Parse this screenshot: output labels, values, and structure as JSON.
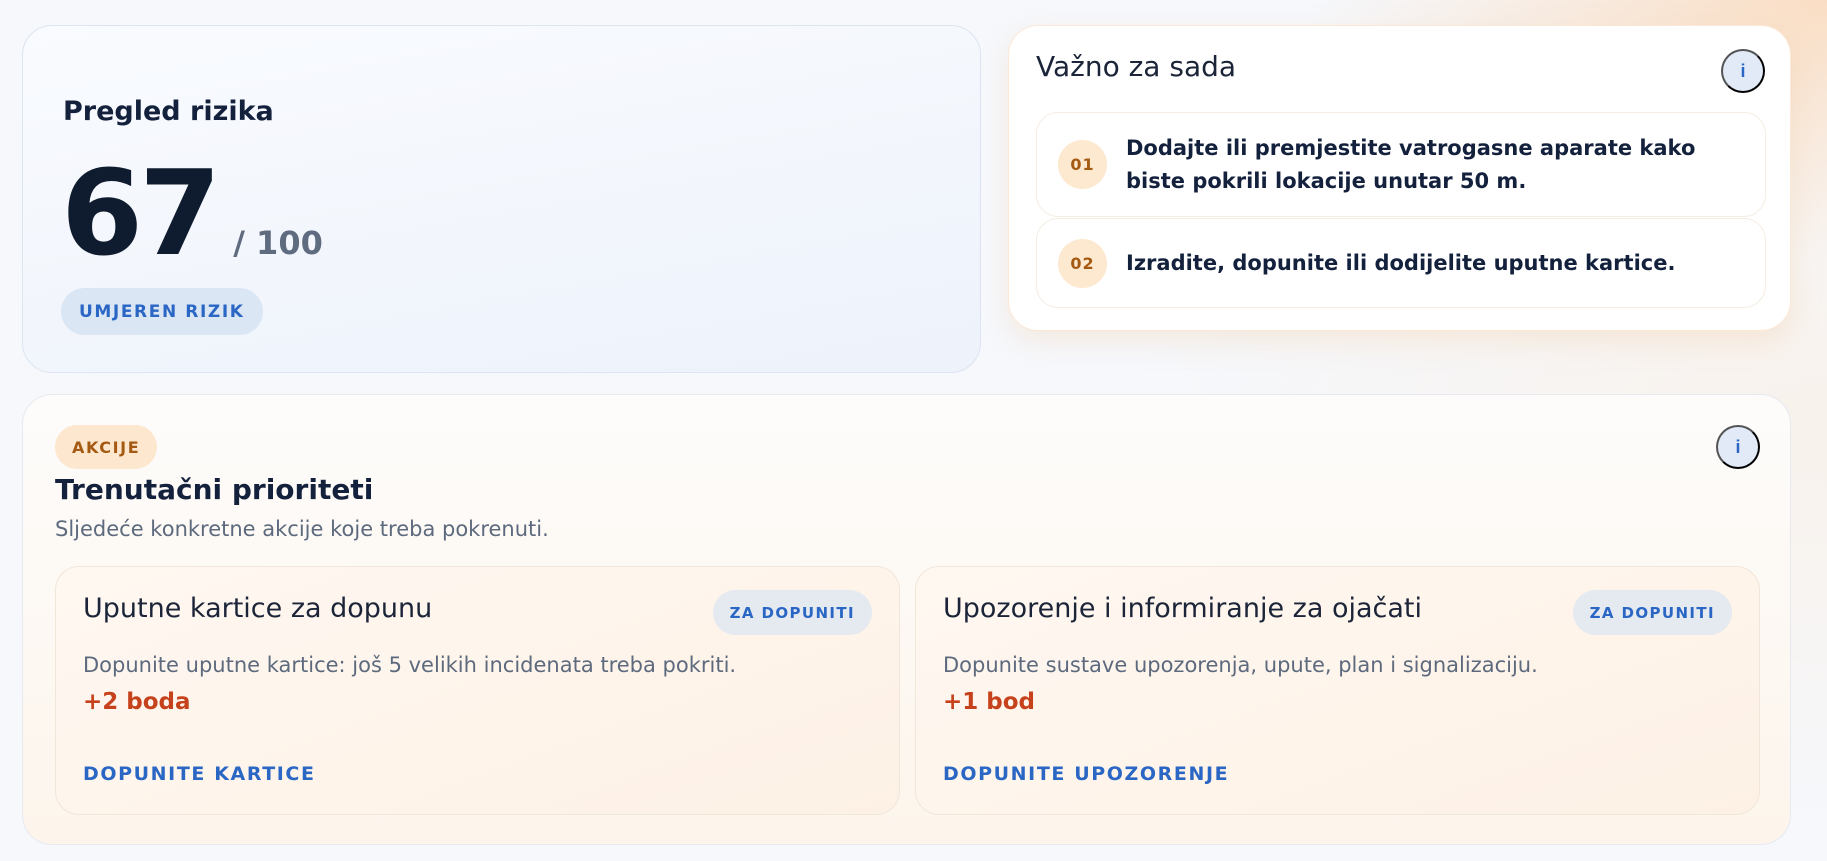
{
  "risk_overview": {
    "title": "Pregled rizika",
    "score": "67",
    "max": "/ 100",
    "level_badge": "UMJEREN RIZIK"
  },
  "important_now": {
    "title": "Važno za sada",
    "info_label": "i",
    "items": [
      {
        "number": "01",
        "text": "Dodajte ili premjestite vatrogasne aparate kako biste pokrili lokacije unutar 50 m."
      },
      {
        "number": "02",
        "text": "Izradite, dopunite ili dodijelite uputne kartice."
      }
    ]
  },
  "actions": {
    "badge": "AKCIJE",
    "info_label": "i",
    "title": "Trenutačni prioriteti",
    "subtitle": "Sljedeće konkretne akcije koje treba pokrenuti.",
    "cards": [
      {
        "title": "Uputne kartice za dopunu",
        "status": "ZA DOPUNITI",
        "description": "Dopunite uputne kartice: još 5 velikih incidenata treba pokriti.",
        "points": "+2 boda",
        "action": "DOPUNITE KARTICE"
      },
      {
        "title": "Upozorenje i informiranje za ojačati",
        "status": "ZA DOPUNITI",
        "description": "Dopunite sustave upozorenja, upute, plan i signalizaciju.",
        "points": "+1 bod",
        "action": "DOPUNITE UPOZORENJE"
      }
    ]
  },
  "colors": {
    "accent_blue": "#2a66c4",
    "accent_orange": "#a45a12",
    "points_red": "#c6421c",
    "text_dark": "#14213d",
    "text_muted": "#5d6a7e"
  }
}
